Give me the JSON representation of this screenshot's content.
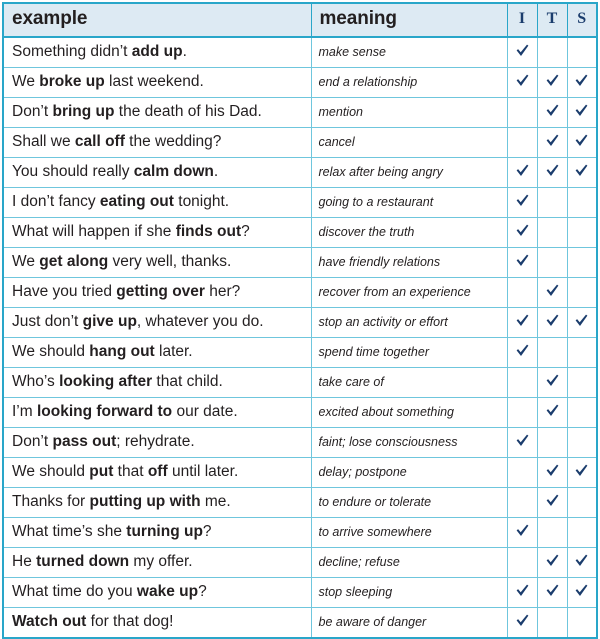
{
  "table": {
    "headers": {
      "example": "example",
      "meaning": "meaning",
      "col_i": "I",
      "col_t": "T",
      "col_s": "S"
    },
    "colors": {
      "border_outer": "#29a6c9",
      "border_inner": "#6fc6dd",
      "header_bg": "#ddeaf3",
      "tick": "#1b3d6d",
      "text": "#231f20",
      "header_letter": "#1b3d6d"
    },
    "icons": {
      "tick": "check-icon"
    },
    "rows": [
      {
        "example_pre": "Something didn’t ",
        "example_bold": "add up",
        "example_post": ".",
        "meaning": "make sense",
        "i": true,
        "t": false,
        "s": false
      },
      {
        "example_pre": "We ",
        "example_bold": "broke up",
        "example_post": " last weekend.",
        "meaning": "end a relationship",
        "i": true,
        "t": true,
        "s": true
      },
      {
        "example_pre": "Don’t ",
        "example_bold": "bring up",
        "example_post": " the death of his Dad.",
        "meaning": "mention",
        "i": false,
        "t": true,
        "s": true
      },
      {
        "example_pre": "Shall we ",
        "example_bold": "call off",
        "example_post": " the wedding?",
        "meaning": "cancel",
        "i": false,
        "t": true,
        "s": true
      },
      {
        "example_pre": "You should really ",
        "example_bold": "calm down",
        "example_post": ".",
        "meaning": "relax after being angry",
        "i": true,
        "t": true,
        "s": true
      },
      {
        "example_pre": "I don’t fancy ",
        "example_bold": "eating out",
        "example_post": " tonight.",
        "meaning": "going to a restaurant",
        "i": true,
        "t": false,
        "s": false
      },
      {
        "example_pre": "What will happen if she ",
        "example_bold": "finds out",
        "example_post": "?",
        "meaning": "discover the truth",
        "i": true,
        "t": false,
        "s": false
      },
      {
        "example_pre": "We ",
        "example_bold": "get along",
        "example_post": " very well, thanks.",
        "meaning": "have friendly relations",
        "i": true,
        "t": false,
        "s": false
      },
      {
        "example_pre": "Have you tried ",
        "example_bold": "getting over",
        "example_post": " her?",
        "meaning": "recover from an experience",
        "i": false,
        "t": true,
        "s": false
      },
      {
        "example_pre": "Just don’t ",
        "example_bold": "give up",
        "example_post": ", whatever you do.",
        "meaning": "stop an activity or effort",
        "i": true,
        "t": true,
        "s": true
      },
      {
        "example_pre": "We should ",
        "example_bold": "hang out",
        "example_post": " later.",
        "meaning": "spend time together",
        "i": true,
        "t": false,
        "s": false
      },
      {
        "example_pre": "Who’s ",
        "example_bold": "looking after",
        "example_post": " that child.",
        "meaning": "take care of",
        "i": false,
        "t": true,
        "s": false
      },
      {
        "example_pre": "I’m ",
        "example_bold": "looking forward to",
        "example_post": " our date.",
        "meaning": "excited about something",
        "i": false,
        "t": true,
        "s": false
      },
      {
        "example_pre": "Don’t ",
        "example_bold": "pass out",
        "example_post": "; rehydrate.",
        "meaning": "faint; lose consciousness",
        "i": true,
        "t": false,
        "s": false
      },
      {
        "example_pre": "We should ",
        "example_bold": "put",
        "example_mid": " that ",
        "example_bold2": "off",
        "example_post": " until later.",
        "meaning": "delay; postpone",
        "i": false,
        "t": true,
        "s": true
      },
      {
        "example_pre": "Thanks for ",
        "example_bold": "putting up with",
        "example_post": " me.",
        "meaning": "to endure or tolerate",
        "i": false,
        "t": true,
        "s": false
      },
      {
        "example_pre": "What time’s she ",
        "example_bold": "turning up",
        "example_post": "?",
        "meaning": "to arrive somewhere",
        "i": true,
        "t": false,
        "s": false
      },
      {
        "example_pre": "He ",
        "example_bold": "turned down",
        "example_post": " my offer.",
        "meaning": "decline; refuse",
        "i": false,
        "t": true,
        "s": true
      },
      {
        "example_pre": "What time do you ",
        "example_bold": "wake up",
        "example_post": "?",
        "meaning": "stop sleeping",
        "i": true,
        "t": true,
        "s": true
      },
      {
        "example_pre": "",
        "example_bold": "Watch out",
        "example_post": " for that dog!",
        "meaning": "be aware of danger",
        "i": true,
        "t": false,
        "s": false
      }
    ]
  }
}
